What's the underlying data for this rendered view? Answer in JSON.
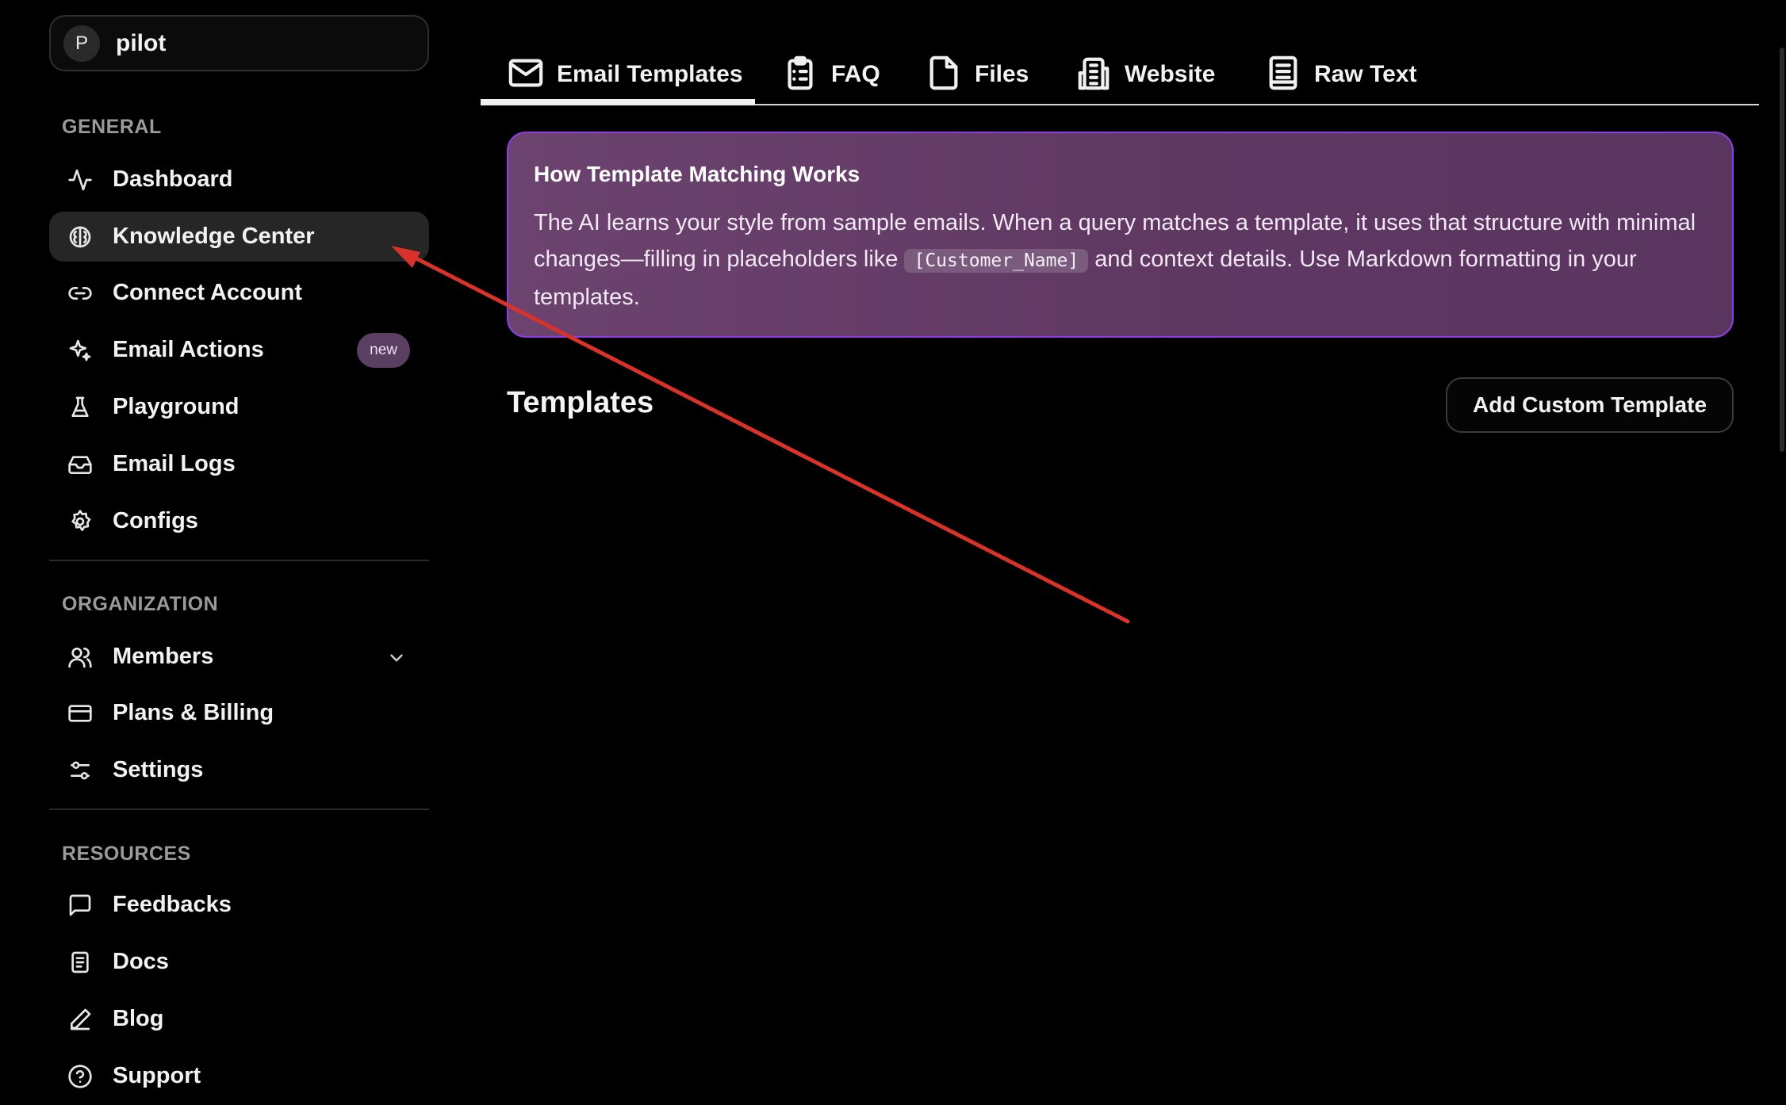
{
  "workspace": {
    "avatar_letter": "P",
    "name": "pilot"
  },
  "sidebar": {
    "sections": {
      "general": "GENERAL",
      "organization": "ORGANIZATION",
      "resources": "RESOURCES"
    },
    "general_items": [
      {
        "label": "Dashboard",
        "icon": "activity-icon"
      },
      {
        "label": "Knowledge Center",
        "icon": "brain-icon",
        "active": true
      },
      {
        "label": "Connect Account",
        "icon": "link-icon"
      },
      {
        "label": "Email Actions",
        "icon": "sparkles-icon",
        "badge": "new"
      },
      {
        "label": "Playground",
        "icon": "flask-icon"
      },
      {
        "label": "Email Logs",
        "icon": "inbox-icon"
      },
      {
        "label": "Configs",
        "icon": "gear-icon"
      }
    ],
    "organization_items": [
      {
        "label": "Members",
        "icon": "users-icon"
      },
      {
        "label": "Plans & Billing",
        "icon": "credit-card-icon"
      },
      {
        "label": "Settings",
        "icon": "sliders-icon"
      }
    ],
    "resources_items": [
      {
        "label": "Feedbacks",
        "icon": "message-square-icon"
      },
      {
        "label": "Docs",
        "icon": "document-icon"
      },
      {
        "label": "Blog",
        "icon": "pen-icon"
      },
      {
        "label": "Support",
        "icon": "help-circle-icon"
      }
    ]
  },
  "tabs": [
    {
      "label": "Email Templates",
      "icon": "mail-icon",
      "active": true
    },
    {
      "label": "FAQ",
      "icon": "clipboard-list-icon"
    },
    {
      "label": "Files",
      "icon": "file-icon"
    },
    {
      "label": "Website",
      "icon": "building-icon"
    },
    {
      "label": "Raw Text",
      "icon": "text-document-icon"
    }
  ],
  "info": {
    "title": "How Template Matching Works",
    "body_part1": "The AI learns your style from sample emails. When a query matches a template, it uses that structure with minimal changes—filling in placeholders like ",
    "placeholder_code": "[Customer_Name]",
    "body_part2": " and context details. Use Markdown formatting in your templates."
  },
  "templates": {
    "heading": "Templates",
    "add_button": "Add Custom Template"
  },
  "colors": {
    "background": "#000000",
    "active_nav": "#262626",
    "info_border": "#8b3fe0",
    "info_bg": "#6c436f",
    "badge_bg": "#5b3f63",
    "annotation_arrow": "#d9322a"
  }
}
